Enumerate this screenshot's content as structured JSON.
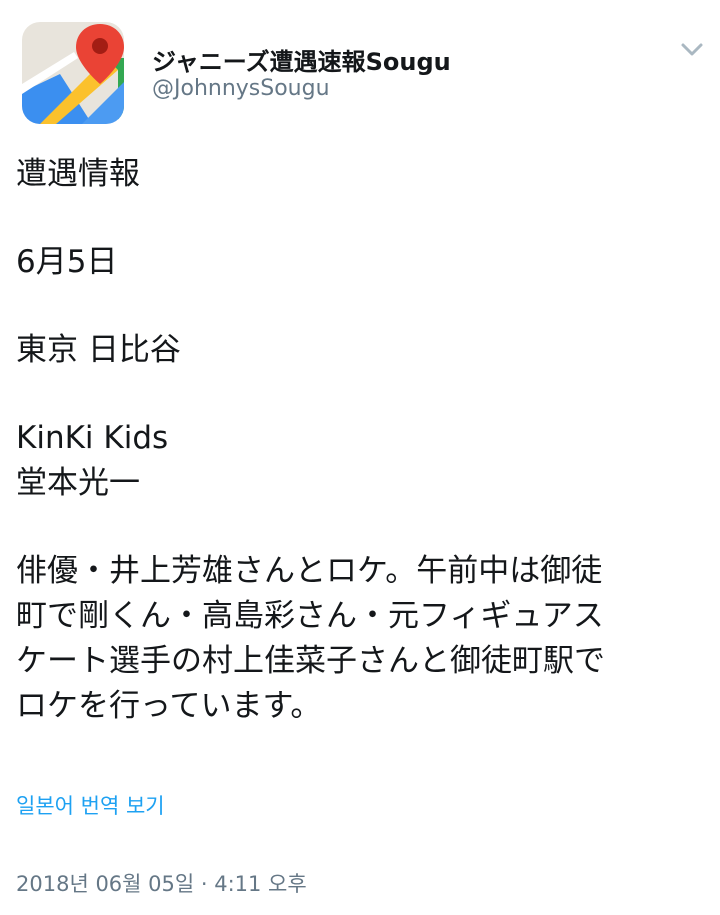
{
  "user": {
    "display_name": "ジャニーズ遭遇速報Sougu",
    "handle": "@JohnnysSougu",
    "avatar_icon": "maps-pin-icon"
  },
  "tweet": {
    "line1": "遭遇情報",
    "line2": "6月5日",
    "line3": "東京 日比谷",
    "line4a": "KinKi Kids",
    "line4b": "堂本光一",
    "line5a": "俳優・井上芳雄さんとロケ。午前中は御徒",
    "line5b": "町で剛くん・高島彩さん・元フィギュアス",
    "line5c": "ケート選手の村上佳菜子さんと御徒町駅で",
    "line5d": "ロケを行っています。"
  },
  "translate_label": "일본어 번역 보기",
  "timestamp": "2018년 06월 05일 · 4:11 오후",
  "colors": {
    "accent": "#1da1f2",
    "secondary_text": "#657786",
    "primary_text": "#14171a"
  }
}
